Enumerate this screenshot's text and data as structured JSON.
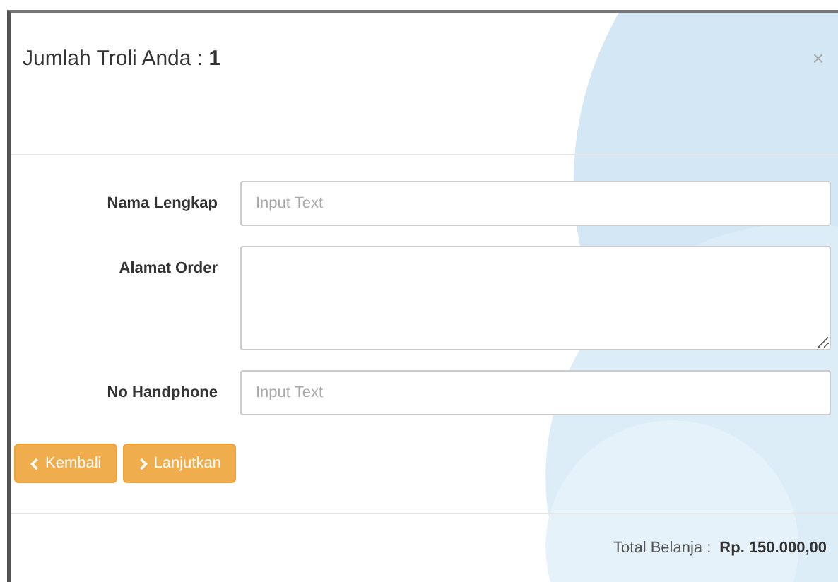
{
  "modal": {
    "title": "Jumlah Troli Anda : **1**",
    "close": "×"
  },
  "fields": [
    {
      "label": "Nama Lengkap",
      "kind": "input",
      "placeholder": "Input Text"
    },
    {
      "label": "Alamat Order",
      "kind": "textarea"
    },
    {
      "label": "No Handphone",
      "kind": "input",
      "placeholder": "Input Text"
    }
  ],
  "buttons": [
    {
      "label": "Kembali",
      "kind": "back"
    },
    {
      "label": "Lanjutkan",
      "kind": "next"
    }
  ],
  "footer": {
    "label": "Total Belanja :",
    "total": "Rp. 150.000,00"
  }
}
